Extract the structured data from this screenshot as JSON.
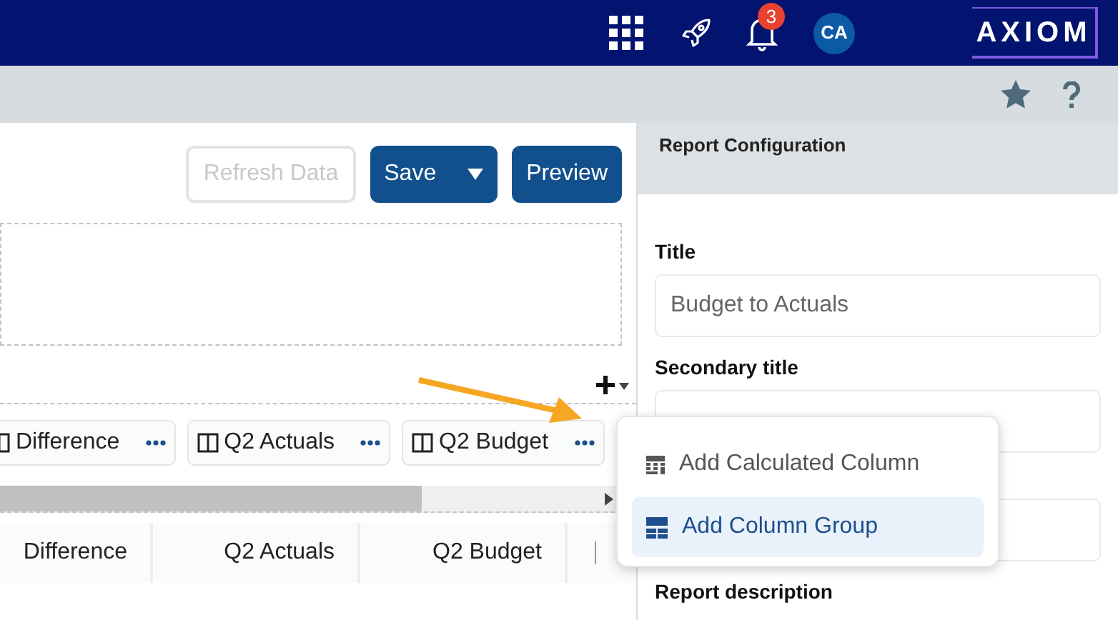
{
  "header": {
    "notification_count": "3",
    "avatar_initials": "CA",
    "logo": "AXIOM"
  },
  "toolbar": {
    "buttons": [
      {
        "label": "Refresh Data",
        "kind": "plain",
        "disabled": true
      },
      {
        "label": "Save",
        "kind": "split",
        "disabled": false
      },
      {
        "label": "Preview",
        "kind": "plain",
        "disabled": false
      }
    ]
  },
  "column_chips": [
    {
      "label": "Difference"
    },
    {
      "label": "Q2 Actuals"
    },
    {
      "label": "Q2 Budget"
    }
  ],
  "table": {
    "columns": [
      "Difference",
      "Q2 Actuals",
      "Q2 Budget"
    ]
  },
  "add_menu": {
    "items": [
      {
        "label": "Add Calculated Column",
        "kind": "calculated",
        "selected": false
      },
      {
        "label": "Add Column Group",
        "kind": "group",
        "selected": true
      }
    ]
  },
  "config_panel": {
    "title": "Report Configuration",
    "fields": [
      {
        "kind": "text",
        "label": "Title",
        "value": "Budget to Actuals"
      },
      {
        "kind": "text",
        "label": "Secondary title"
      },
      {
        "kind": "text"
      }
    ],
    "next_label": "Report description"
  }
}
